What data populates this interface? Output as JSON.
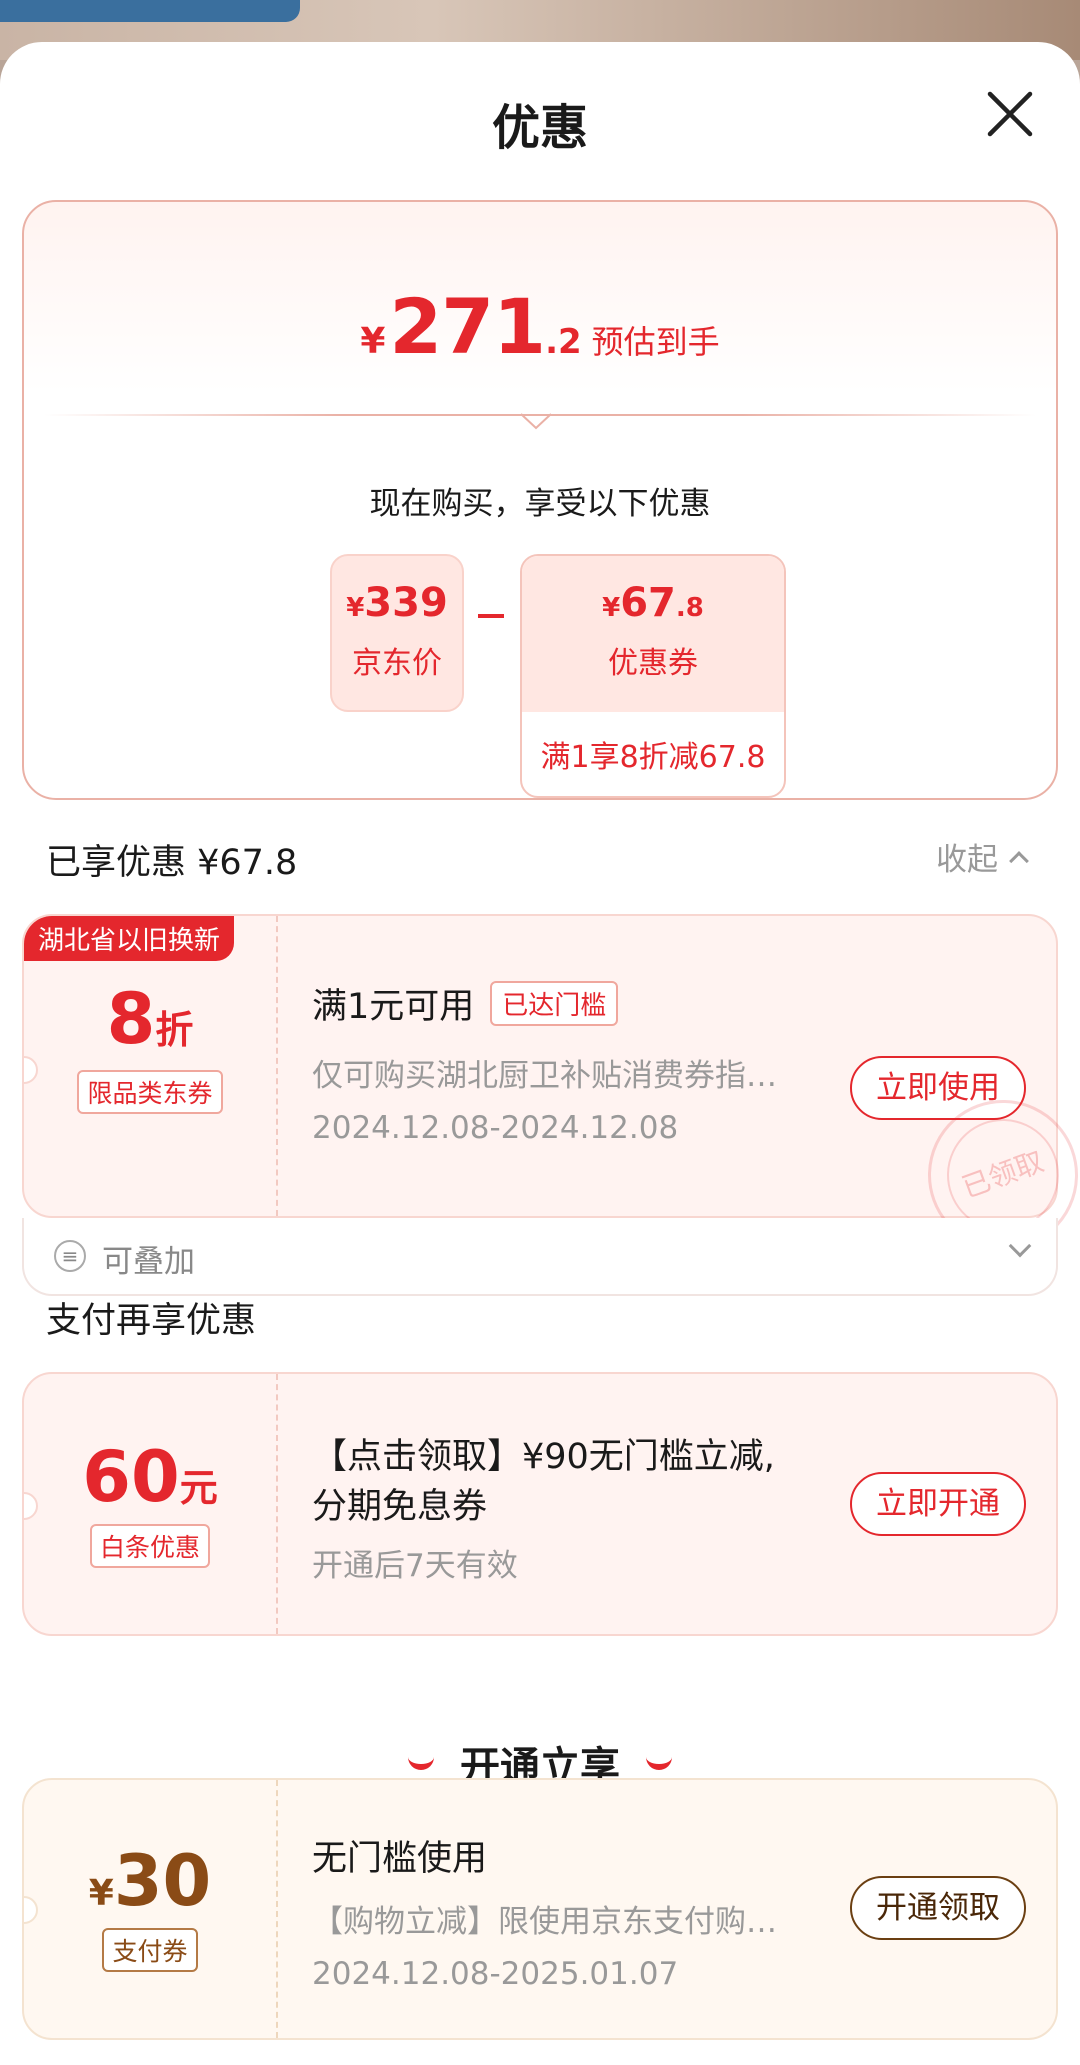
{
  "header": {
    "title": "优惠"
  },
  "summary": {
    "yen": "¥",
    "price_int": "271",
    "price_dec": ".2",
    "price_label": "预估到手",
    "subtitle": "现在购买，享受以下优惠",
    "jd_price_value": "339",
    "jd_price_label": "京东价",
    "coupon_value": "67",
    "coupon_value_dec": ".8",
    "coupon_label": "优惠券",
    "coupon_condition": "满1享8折减67.8"
  },
  "enjoyed": {
    "title": "已享优惠 ¥67.8",
    "collapse_label": "收起"
  },
  "coupon1": {
    "ribbon": "湖北省以旧换新",
    "value": "8",
    "unit": "折",
    "tag": "限品类东券",
    "title": "满1元可用",
    "badge": "已达门槛",
    "desc": "仅可购买湖北厨卫补贴消费券指…",
    "date": "2024.12.08-2024.12.08",
    "button": "立即使用",
    "stamp": "已领取",
    "stack_label": "可叠加"
  },
  "pay": {
    "title": "支付再享优惠",
    "value": "60",
    "unit": "元",
    "tag": "白条优惠",
    "line1": "【点击领取】¥90无门槛立减,",
    "line2": "分期免息券",
    "desc": "开通后7天有效",
    "button": "立即开通"
  },
  "open": {
    "title": "开通立享",
    "yen": "¥",
    "value": "30",
    "tag": "支付券",
    "c_title": "无门槛使用",
    "desc": "【购物立减】限使用京东支付购…",
    "date": "2024.12.08-2025.01.07",
    "button": "开通领取"
  },
  "colors": {
    "accent": "#e4272d",
    "gold": "#8a4b16"
  }
}
